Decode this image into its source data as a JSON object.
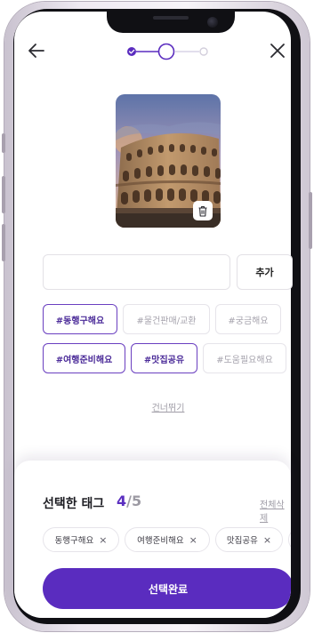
{
  "header": {
    "back_icon": "arrow-left-icon",
    "close_icon": "close-icon",
    "stepper": {
      "current_step": 2,
      "total_steps": 3
    }
  },
  "photo": {
    "description_icon": "colosseum-photo",
    "delete_icon": "trash-icon"
  },
  "tag_input": {
    "value": "",
    "placeholder": ""
  },
  "add_button_label": "추가",
  "tags": [
    {
      "label": "#동행구해요",
      "selected": true
    },
    {
      "label": "#물건판매/교환",
      "selected": false
    },
    {
      "label": "#궁금해요",
      "selected": false
    },
    {
      "label": "#여행준비해요",
      "selected": true
    },
    {
      "label": "#맛집공유",
      "selected": true
    },
    {
      "label": "#도움필요해요",
      "selected": false
    }
  ],
  "skip_label": "건너뛰기",
  "selection": {
    "title": "선택한 태그",
    "count": "4",
    "max": "/5",
    "clear_all_label": "전체삭제",
    "chips": [
      {
        "label": "동행구해요",
        "remove": "×"
      },
      {
        "label": "여행준비해요",
        "remove": "×"
      },
      {
        "label": "맛집공유",
        "remove": "×"
      },
      {
        "label": "",
        "remove": ""
      }
    ]
  },
  "confirm_label": "선택완료",
  "colors": {
    "accent": "#5a2cbf",
    "accent_text": "#4a2a98",
    "muted_text": "#a6a3ad"
  }
}
